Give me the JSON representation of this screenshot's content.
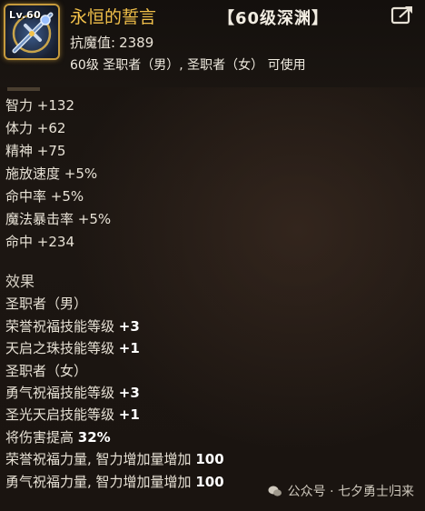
{
  "item": {
    "level_badge": "Lv.60",
    "name": "永恒的誓言",
    "dungeon_tag": "【60级深渊】",
    "resist_label": "抗魔值:",
    "resist_value": "2389",
    "usable_by": "60级 圣职者（男）, 圣职者（女） 可使用"
  },
  "stats": [
    {
      "label": "智力",
      "value": "+132"
    },
    {
      "label": "体力",
      "value": "+62"
    },
    {
      "label": "精神",
      "value": "+75"
    },
    {
      "label": "施放速度",
      "value": "+5%"
    },
    {
      "label": "命中率",
      "value": "+5%"
    },
    {
      "label": "魔法暴击率",
      "value": "+5%"
    },
    {
      "label": "命中",
      "value": "+234"
    }
  ],
  "effects": {
    "title": "效果",
    "lines": [
      {
        "text": "圣职者（男）",
        "value": ""
      },
      {
        "text": "荣誉祝福技能等级",
        "value": "+3"
      },
      {
        "text": "天启之珠技能等级",
        "value": "+1"
      },
      {
        "text": "圣职者（女）",
        "value": ""
      },
      {
        "text": "勇气祝福技能等级",
        "value": "+3"
      },
      {
        "text": "圣光天启技能等级",
        "value": "+1"
      },
      {
        "text": "将伤害提高",
        "value": "32%"
      },
      {
        "text": "荣誉祝福力量, 智力增加量增加",
        "value": "100"
      },
      {
        "text": "勇气祝福力量, 智力增加量增加",
        "value": "100"
      }
    ]
  },
  "watermark": "公众号 · 七夕勇士归来",
  "icons": {
    "item": "cross-staff-icon",
    "share": "share-icon",
    "watermark": "wechat-icon"
  },
  "colors": {
    "item_name": "#f2c14a",
    "frame": "#c69a3c",
    "text": "#e8e2d6",
    "background": "#1a1410"
  }
}
